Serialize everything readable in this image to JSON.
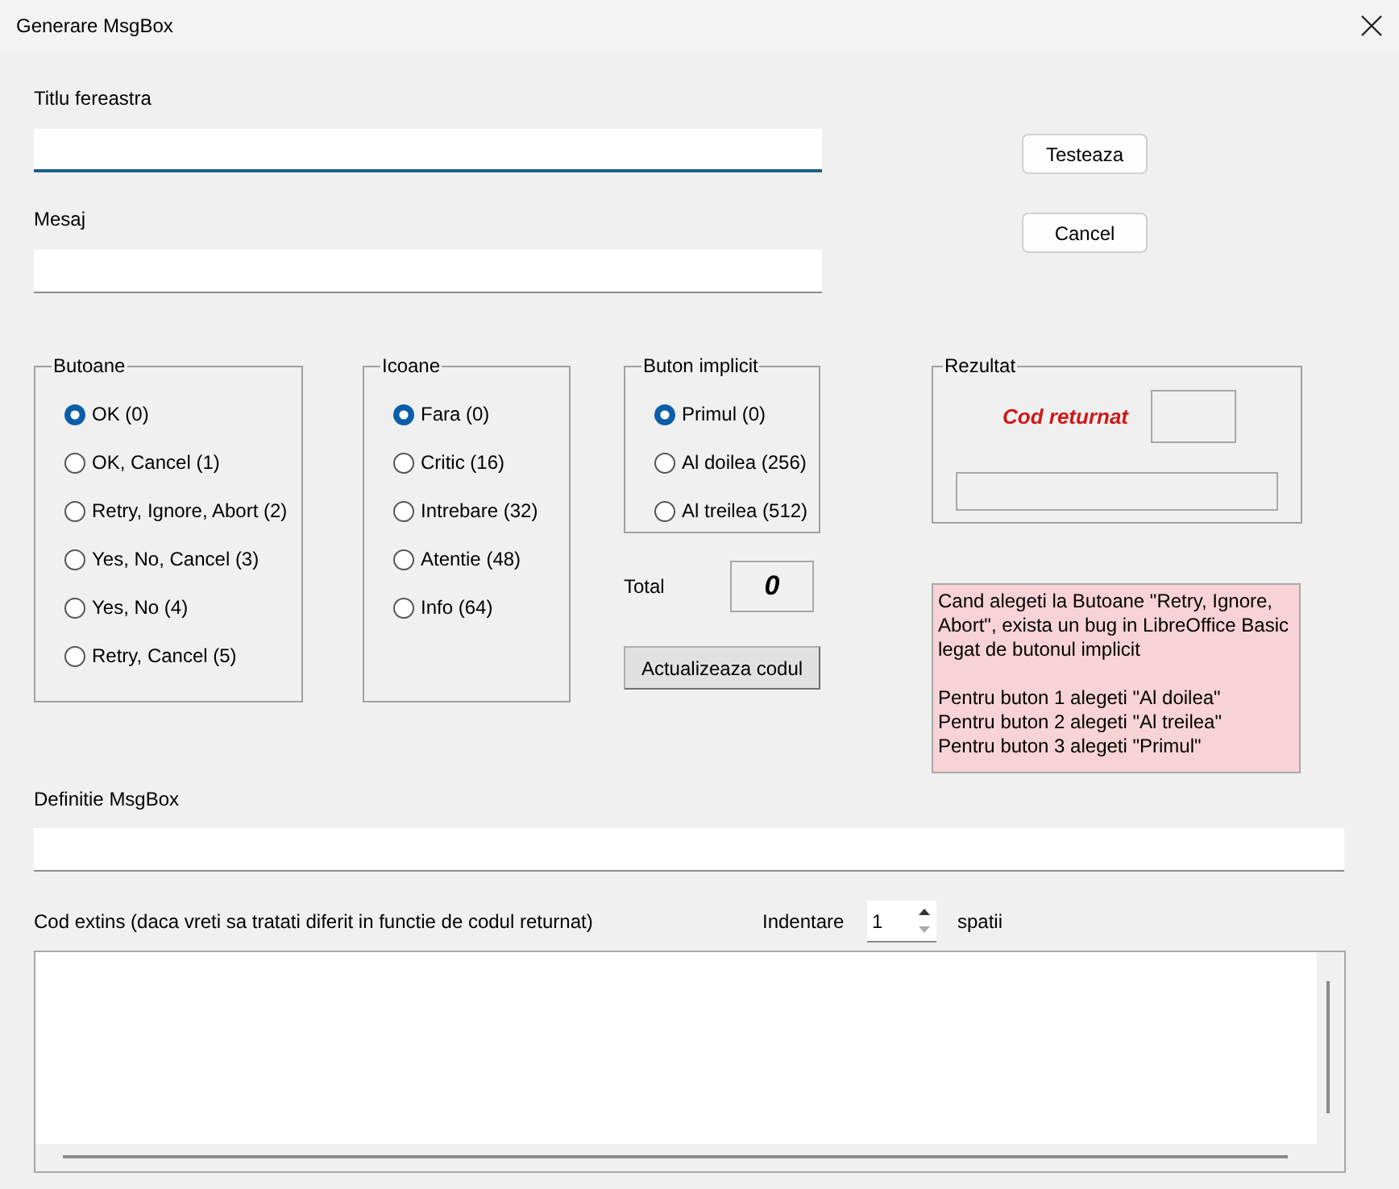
{
  "window": {
    "title": "Generare MsgBox"
  },
  "fields": [
    {
      "label": "Titlu fereastra",
      "focused": true
    },
    {
      "label": "Mesaj",
      "focused": false
    }
  ],
  "actions": [
    "Testeaza",
    "Cancel"
  ],
  "groups": [
    {
      "title": "Butoane",
      "options": [
        {
          "label": "OK (0)",
          "selected": true
        },
        {
          "label": "OK, Cancel (1)",
          "selected": false
        },
        {
          "label": "Retry, Ignore, Abort (2)",
          "selected": false
        },
        {
          "label": "Yes, No, Cancel (3)",
          "selected": false
        },
        {
          "label": "Yes, No (4)",
          "selected": false
        },
        {
          "label": "Retry, Cancel (5)",
          "selected": false
        }
      ]
    },
    {
      "title": "Icoane",
      "options": [
        {
          "label": "Fara (0)",
          "selected": true
        },
        {
          "label": "Critic (16)",
          "selected": false
        },
        {
          "label": "Intrebare (32)",
          "selected": false
        },
        {
          "label": "Atentie (48)",
          "selected": false
        },
        {
          "label": "Info (64)",
          "selected": false
        }
      ]
    },
    {
      "title": "Buton implicit",
      "options": [
        {
          "label": "Primul (0)",
          "selected": true
        },
        {
          "label": "Al doilea (256)",
          "selected": false
        },
        {
          "label": "Al treilea (512)",
          "selected": false
        }
      ]
    }
  ],
  "total": {
    "label": "Total",
    "value": "0"
  },
  "update_button": "Actualizeaza codul",
  "result": {
    "title": "Rezultat",
    "code_label": "Cod returnat"
  },
  "note": "Cand alegeti la Butoane \"Retry, Ignore, Abort\", exista un bug in LibreOffice  Basic legat de butonul implicit\n\nPentru buton 1 alegeti \"Al doilea\"\nPentru buton 2 alegeti \"Al treilea\"\nPentru buton 3 alegeti \"Primul\"",
  "definition": {
    "label": "Definitie MsgBox"
  },
  "extended_code": {
    "label": "Cod extins (daca vreti sa tratati diferit in functie de codul returnat)",
    "indent_label": "Indentare",
    "indent_value": "1",
    "indent_unit": "spatii"
  }
}
